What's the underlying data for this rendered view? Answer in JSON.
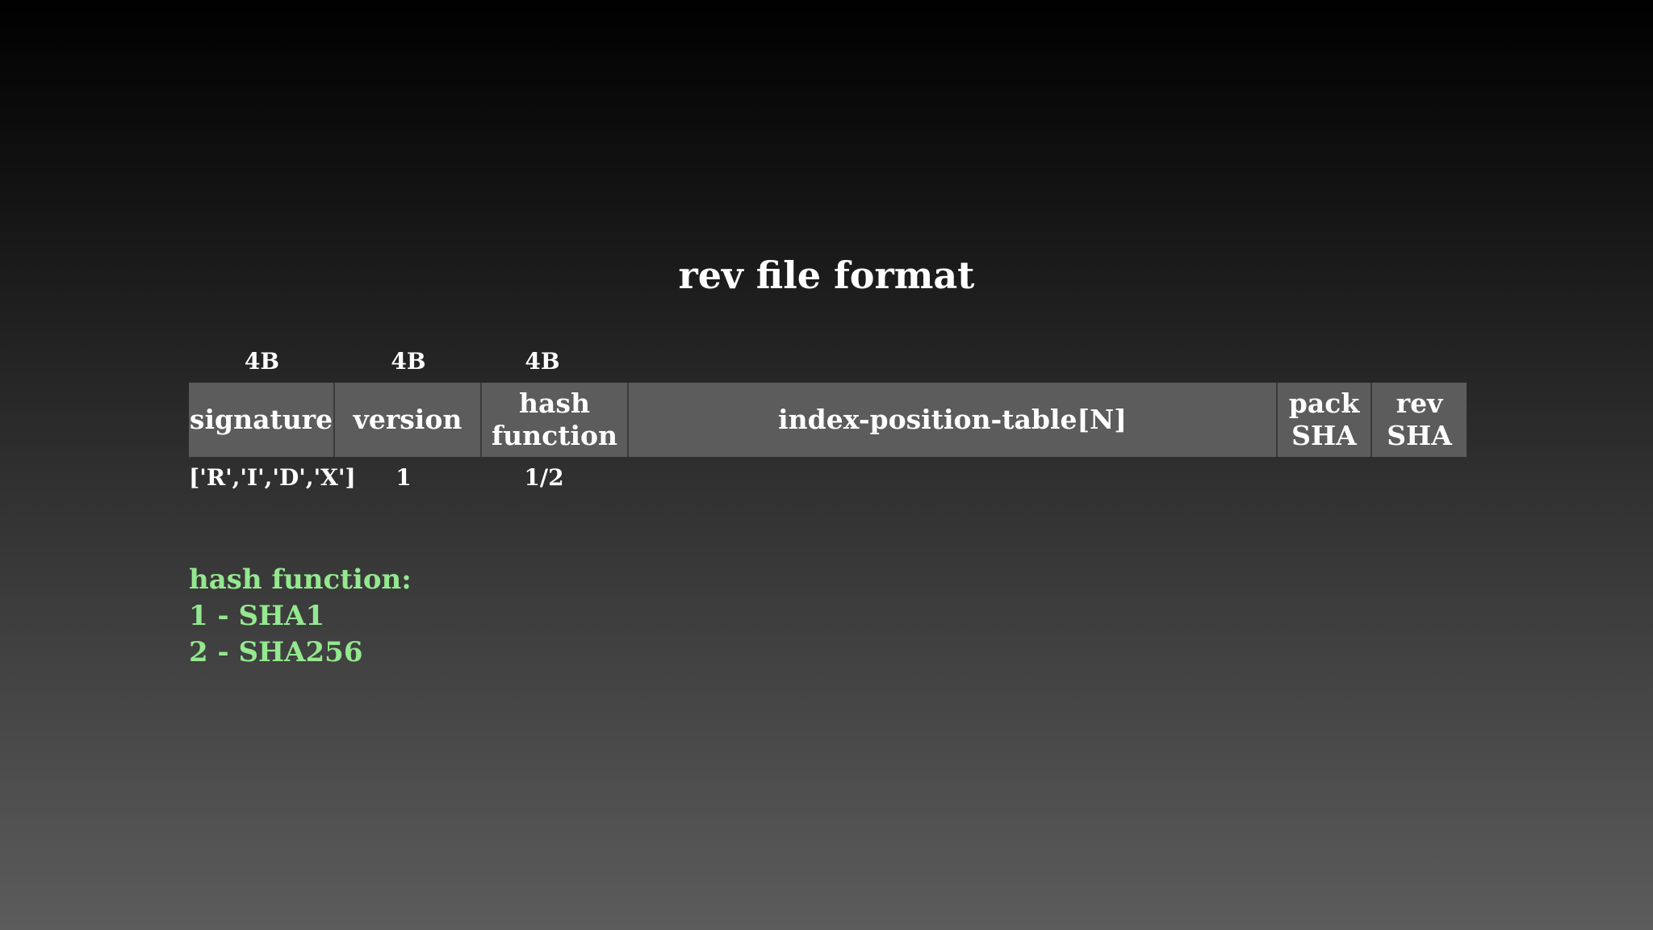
{
  "title": "rev file format",
  "fields": [
    {
      "name": "signature",
      "size": "4B",
      "value": "['R','I','D','X']"
    },
    {
      "name": "version",
      "size": "4B",
      "value": "1"
    },
    {
      "name": "hash\nfunction",
      "size": "4B",
      "value": "1/2"
    },
    {
      "name": "index-position-table[N]"
    },
    {
      "name": "pack\nSHA"
    },
    {
      "name": "rev\nSHA"
    }
  ],
  "notes": {
    "heading": "hash function:",
    "lines": [
      "1 - SHA1",
      "2 - SHA256"
    ]
  },
  "colors": {
    "cell_background": "#5c5c5c",
    "note_text": "#94e88f"
  }
}
